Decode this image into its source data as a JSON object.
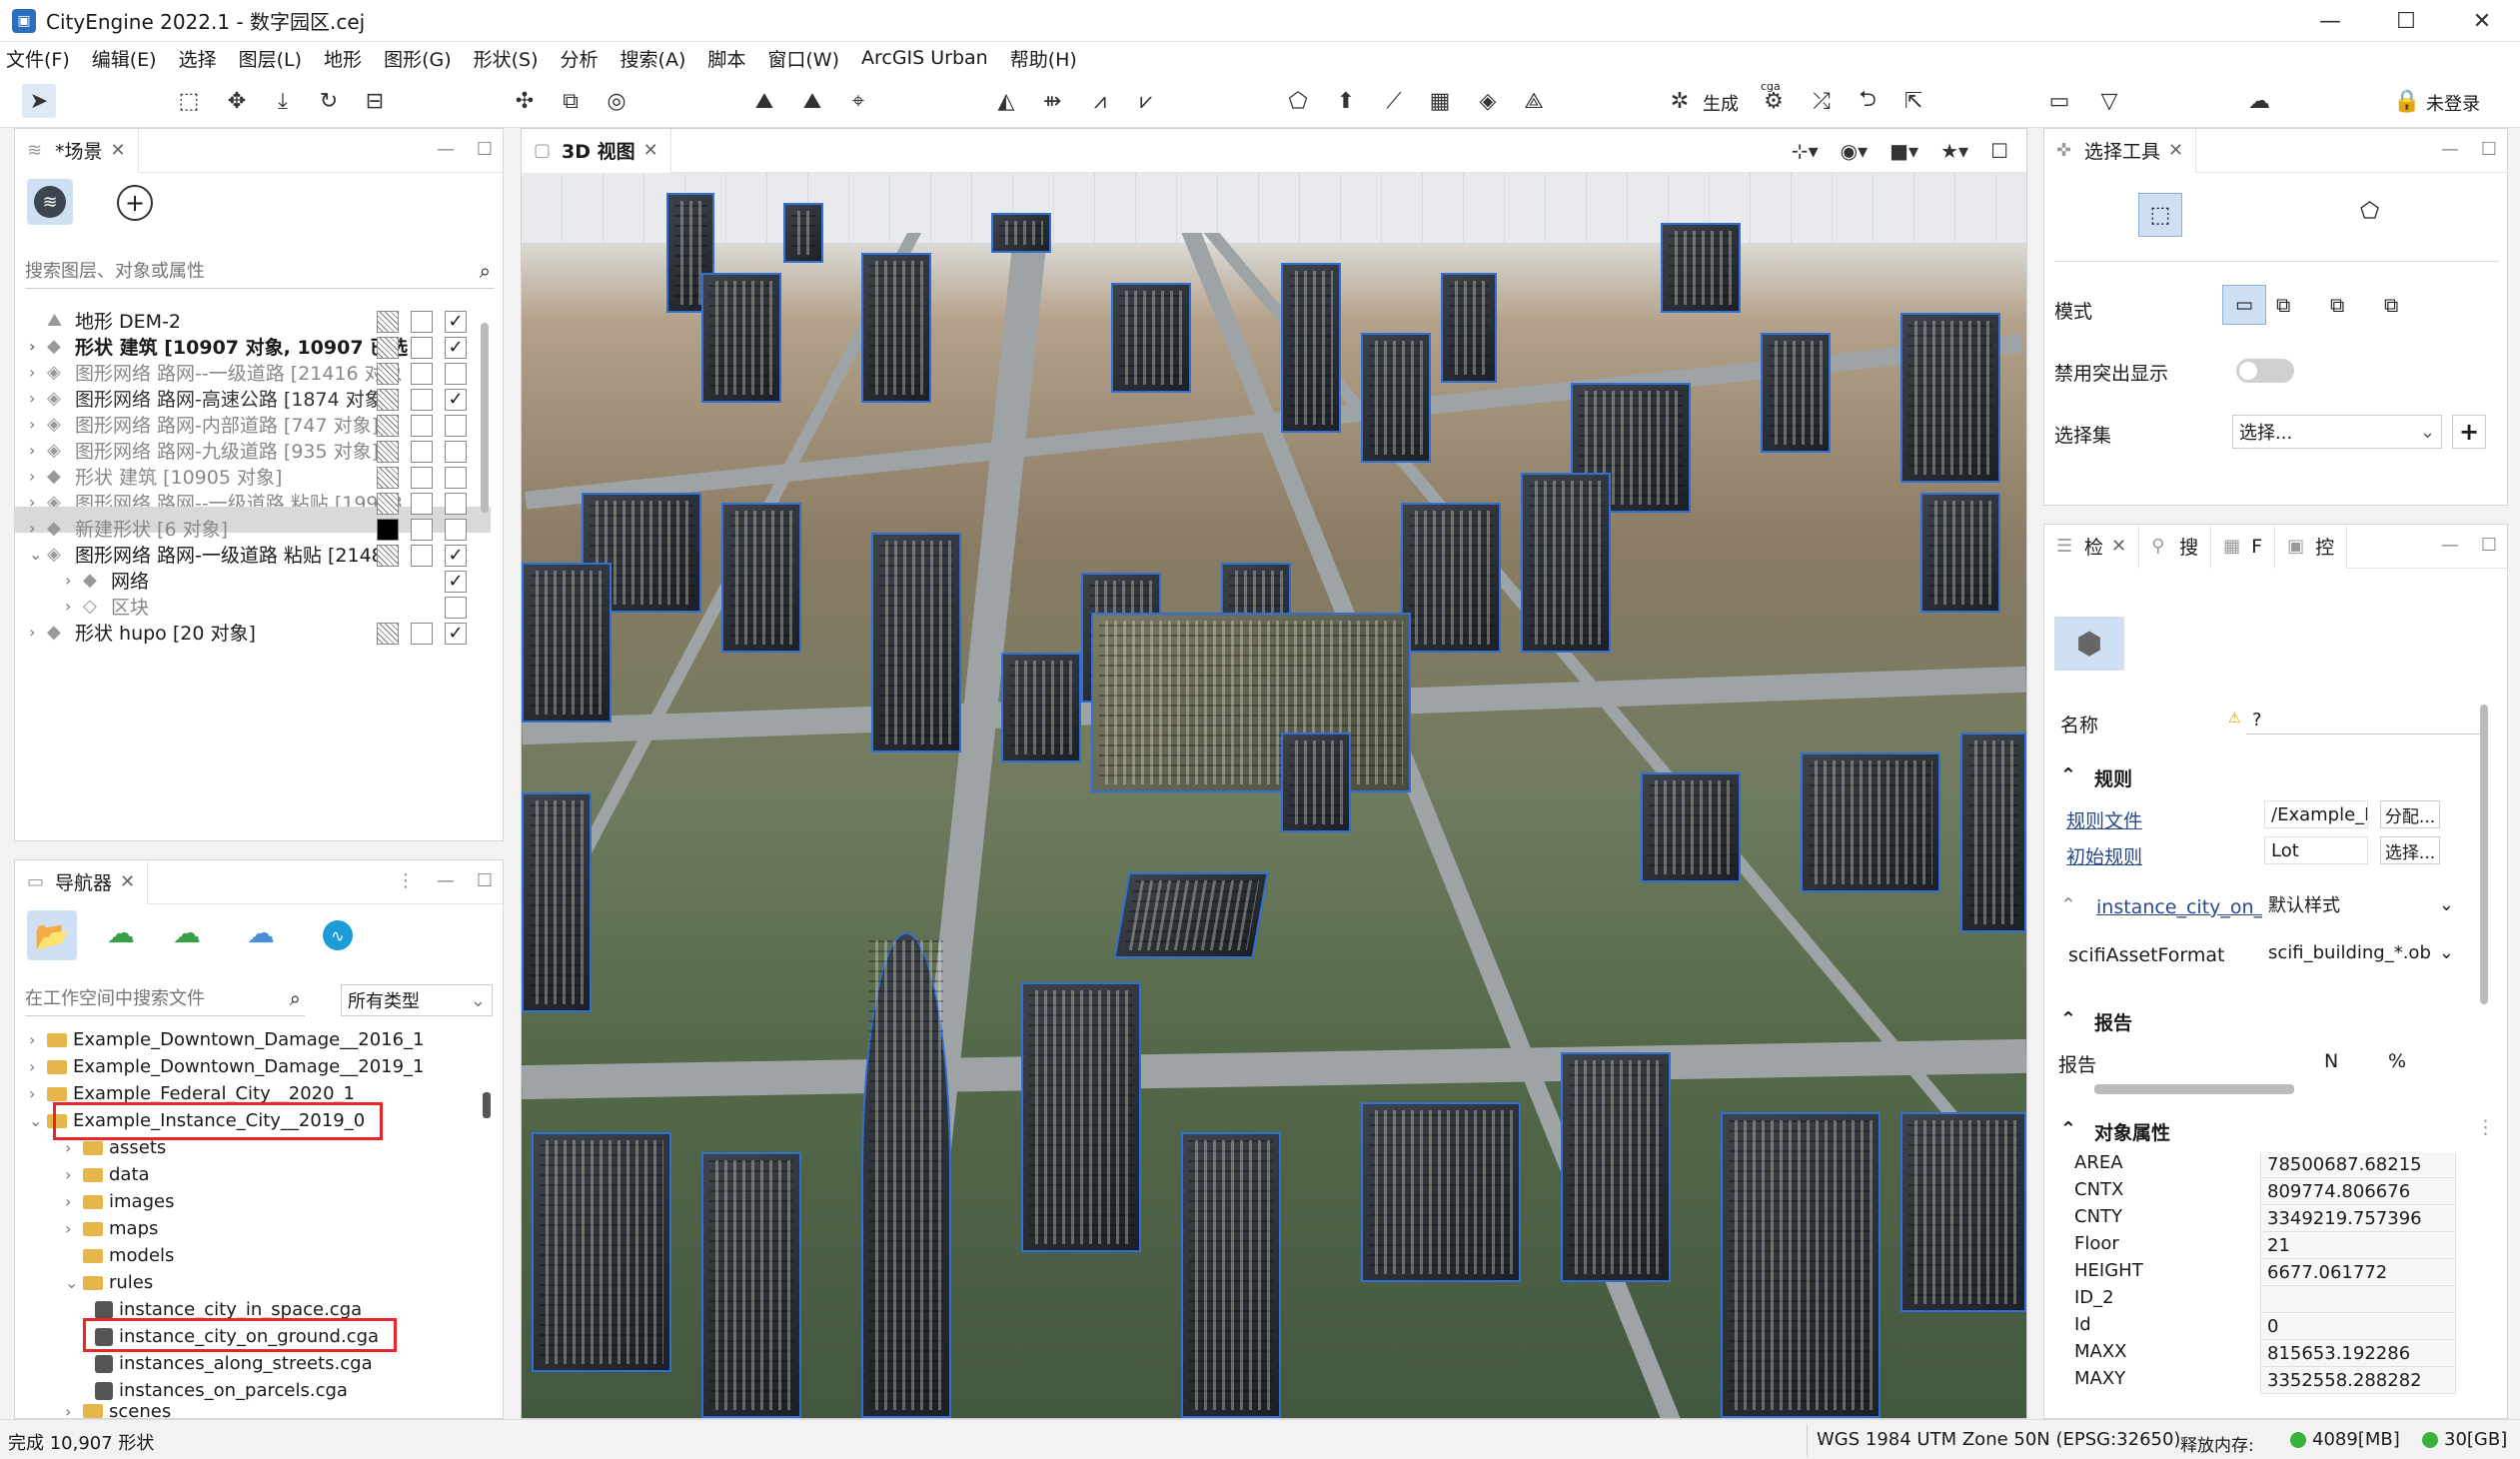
{
  "window": {
    "title": "CityEngine 2022.1 - 数字园区.cej",
    "minimize": "—",
    "maximize": "☐",
    "close": "✕"
  },
  "menu": [
    "文件(F)",
    "编辑(E)",
    "选择",
    "图层(L)",
    "地形",
    "图形(G)",
    "形状(S)",
    "分析",
    "搜索(A)",
    "脚本",
    "窗口(W)",
    "ArcGIS Urban",
    "帮助(H)"
  ],
  "toolbar": {
    "generate_label": "生成",
    "cga_label": "cga",
    "login_label": "未登录"
  },
  "scene_panel": {
    "tab": "*场景",
    "search_placeholder": "搜索图层、对象或属性",
    "layers": [
      {
        "name": "地形 DEM-2",
        "bold": false
      },
      {
        "name": "形状 建筑 [10907 对象, 10907 已选",
        "bold": true
      },
      {
        "name": "图形网络 路网--一级道路 [21416 对象",
        "bold": false
      },
      {
        "name": "图形网络 路网-高速公路 [1874 对象]",
        "bold": false
      },
      {
        "name": "图形网络 路网-内部道路 [747 对象]",
        "bold": false
      },
      {
        "name": "图形网络 路网-九级道路 [935 对象]",
        "bold": false
      },
      {
        "name": "形状 建筑 [10905 对象]",
        "bold": false
      },
      {
        "name": "图形网络 路网--一级道路 粘贴 [19978",
        "bold": false
      },
      {
        "name": "新建形状 [6 对象]",
        "bold": false
      },
      {
        "name": "图形网络 路网-一级道路 粘贴 [21489",
        "bold": false
      },
      {
        "name": "网络",
        "bold": false
      },
      {
        "name": "区块",
        "bold": false
      },
      {
        "name": "形状 hupo [20 对象]",
        "bold": false
      }
    ]
  },
  "navigator": {
    "tab": "导航器",
    "search_placeholder": "在工作空间中搜索文件",
    "type_select": "所有类型",
    "items": [
      "Example_Downtown_Damage__2016_1",
      "Example_Downtown_Damage__2019_1",
      "Example_Federal_City__2020_1",
      "Example_Instance_City__2019_0",
      "assets",
      "data",
      "images",
      "maps",
      "models",
      "rules",
      "instance_city_in_space.cga",
      "instance_city_on_ground.cga",
      "instances_along_streets.cga",
      "instances_on_parcels.cga",
      "scenes"
    ]
  },
  "viewport": {
    "tab": "3D 视图"
  },
  "select_tool": {
    "tab": "选择工具",
    "mode_label": "模式",
    "disable_highlight_label": "禁用突出显示",
    "selection_set_label": "选择集",
    "selection_set_value": "选择..."
  },
  "inspector": {
    "tabs": [
      "检",
      "搜",
      "F",
      "控"
    ],
    "name_label": "名称",
    "name_value": "?",
    "rules_section": "规则",
    "rule_file_label": "规则文件",
    "rule_file_value": "/Example_I",
    "assign_button": "分配...",
    "start_rule_label": "初始规则",
    "start_rule_value": "Lot",
    "select_button": "选择...",
    "style_label": "instance_city_on_",
    "style_value": "默认样式",
    "asset_format_label": "scifiAssetFormat",
    "asset_format_value": "scifi_building_*.ob",
    "report_section": "报告",
    "report_col": "报告",
    "report_n": "N",
    "report_pct": "%",
    "attrs_section": "对象属性",
    "attrs": [
      {
        "k": "AREA",
        "v": "78500687.68215"
      },
      {
        "k": "CNTX",
        "v": "809774.806676"
      },
      {
        "k": "CNTY",
        "v": "3349219.757396"
      },
      {
        "k": "Floor",
        "v": "21"
      },
      {
        "k": "HEIGHT",
        "v": "6677.061772"
      },
      {
        "k": "ID_2",
        "v": ""
      },
      {
        "k": "Id",
        "v": "0"
      },
      {
        "k": "MAXX",
        "v": "815653.192286"
      },
      {
        "k": "MAXY",
        "v": "3352558.288282"
      }
    ]
  },
  "status": {
    "left": "完成 10,907 形状",
    "crs": "WGS 1984 UTM Zone 50N (EPSG:32650)",
    "mem_label": "释放内存:",
    "mem1": "4089[MB]",
    "mem2": "30[GB]"
  },
  "colors": {
    "accent": "#2a6ebd",
    "highlight_red": "#e8262a",
    "status_green": "#3bb33b",
    "selection_blue": "#2f6fd6"
  }
}
